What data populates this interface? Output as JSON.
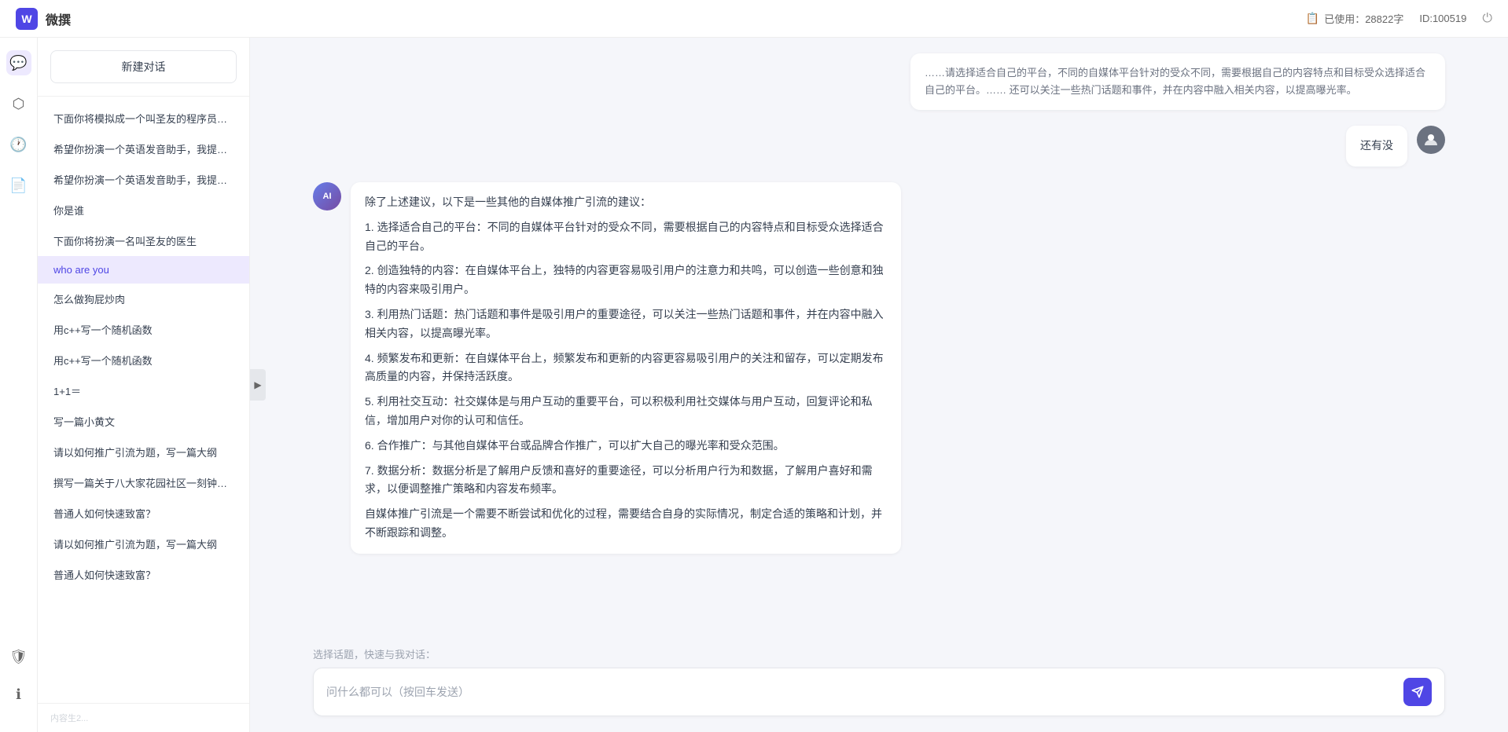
{
  "app": {
    "title": "微撰",
    "logo_text": "W",
    "usage_label": "已使用：28822字",
    "usage_icon": "📋",
    "id_label": "ID:100519",
    "power_icon": "⏻"
  },
  "icon_bar": {
    "items": [
      {
        "name": "chat-icon",
        "symbol": "💬",
        "active": true
      },
      {
        "name": "box-icon",
        "symbol": "⬡",
        "active": false
      },
      {
        "name": "clock-icon",
        "symbol": "🕐",
        "active": false
      },
      {
        "name": "doc-icon",
        "symbol": "📄",
        "active": false
      }
    ],
    "bottom_items": [
      {
        "name": "shield-icon",
        "symbol": "🛡"
      },
      {
        "name": "info-icon",
        "symbol": "ℹ"
      }
    ]
  },
  "sidebar": {
    "new_chat_label": "新建对话",
    "items": [
      {
        "label": "下面你将模拟成一个叫圣友的程序员，我说...",
        "active": false
      },
      {
        "label": "希望你扮演一个英语发音助手，我提供给你...",
        "active": false
      },
      {
        "label": "希望你扮演一个英语发音助手，我提供给你...",
        "active": false
      },
      {
        "label": "你是谁",
        "active": false
      },
      {
        "label": "下面你将扮演一名叫圣友的医生",
        "active": false
      },
      {
        "label": "who are you",
        "active": true
      },
      {
        "label": "怎么做狗屁炒肉",
        "active": false
      },
      {
        "label": "用c++写一个随机函数",
        "active": false
      },
      {
        "label": "用c++写一个随机函数",
        "active": false
      },
      {
        "label": "1+1＝",
        "active": false
      },
      {
        "label": "写一篇小黄文",
        "active": false
      },
      {
        "label": "请以如何推广引流为题，写一篇大纲",
        "active": false
      },
      {
        "label": "撰写一篇关于八大家花园社区一刻钟便民生...",
        "active": false
      },
      {
        "label": "普通人如何快速致富？",
        "active": false
      },
      {
        "label": "请以如何推广引流为题，写一篇大纲",
        "active": false
      },
      {
        "label": "普通人如何快速致富？",
        "active": false
      }
    ],
    "footer_hint": "内容生2..."
  },
  "chat": {
    "truncated_top_text": "……请选择适合自己的平台，不同的自媒体平台针对的受众不同，需要根据自己的内容特点和目标受众选择适合自己的平台。…… 还可以关注一些热门话题和事件，并在内容中融入相关内容，以提高曝光率。",
    "messages": [
      {
        "role": "user",
        "avatar_text": "👤",
        "content": "还有没"
      },
      {
        "role": "ai",
        "avatar_text": "AI",
        "content_paragraphs": [
          "除了上述建议，以下是一些其他的自媒体推广引流的建议：",
          "1. 选择适合自己的平台：不同的自媒体平台针对的受众不同，需要根据自己的内容特点和目标受众选择适合自己的平台。",
          "2. 创造独特的内容：在自媒体平台上，独特的内容更容易吸引用户的注意力和共鸣，可以创造一些创意和独特的内容来吸引用户。",
          "3. 利用热门话题：热门话题和事件是吸引用户的重要途径，可以关注一些热门话题和事件，并在内容中融入相关内容，以提高曝光率。",
          "4. 频繁发布和更新：在自媒体平台上，频繁发布和更新的内容更容易吸引用户的关注和留存，可以定期发布高质量的内容，并保持活跃度。",
          "5. 利用社交互动：社交媒体是与用户互动的重要平台，可以积极利用社交媒体与用户互动，回复评论和私信，增加用户对你的认可和信任。",
          "6. 合作推广：与其他自媒体平台或品牌合作推广，可以扩大自己的曝光率和受众范围。",
          "7. 数据分析：数据分析是了解用户反馈和喜好的重要途径，可以分析用户行为和数据，了解用户喜好和需求，以便调整推广策略和内容发布频率。",
          "自媒体推广引流是一个需要不断尝试和优化的过程，需要结合自身的实际情况，制定合适的策略和计划，并不断跟踪和调整。"
        ]
      }
    ],
    "input_placeholder": "问什么都可以（按回车发送）",
    "quick_select_label": "选择话题，快速与我对话：",
    "send_icon": "✈"
  }
}
